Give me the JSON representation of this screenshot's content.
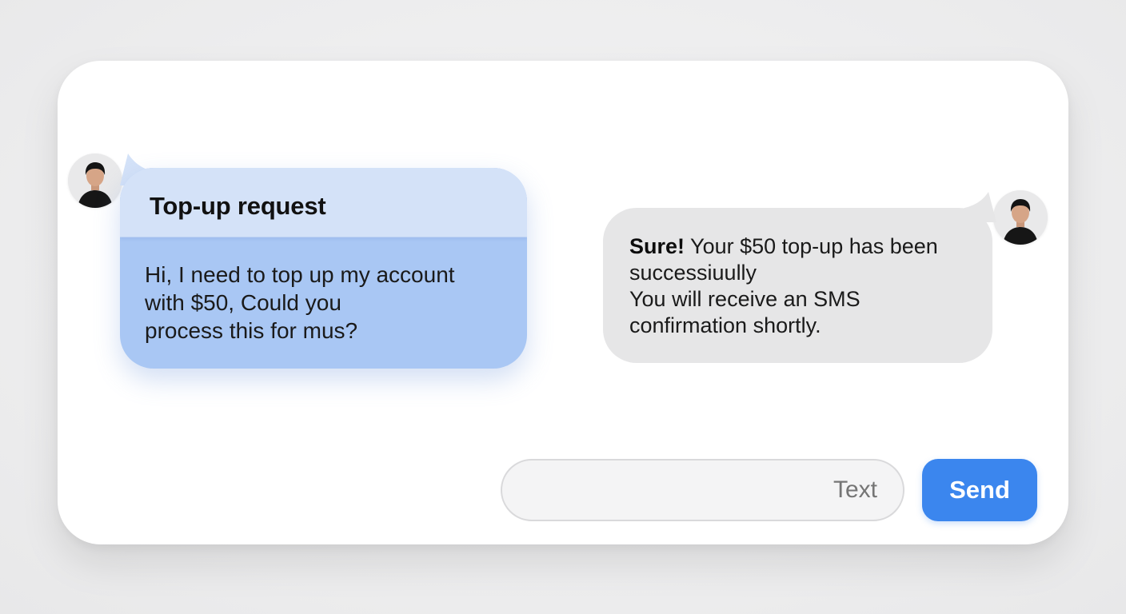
{
  "conversation": {
    "user_message": {
      "title": "Top-up request",
      "lines": [
        "Hi, I need to top up my account",
        "with $50, Could you",
        "process this for mus?"
      ],
      "avatar_icon": "person-avatar-icon"
    },
    "agent_message": {
      "emphasis": "Sure!",
      "lines": [
        " Your $50 top-up has been",
        "successiuully",
        "You will receive an SMS",
        "confirmation shortly."
      ],
      "avatar_icon": "person-avatar-icon"
    }
  },
  "composer": {
    "placeholder": "Text",
    "send_label": "Send"
  },
  "colors": {
    "user_bubble": "#a9c7f4",
    "user_bubble_header": "#d4e2f8",
    "agent_bubble": "#e6e6e7",
    "send_button": "#3b86ee"
  }
}
